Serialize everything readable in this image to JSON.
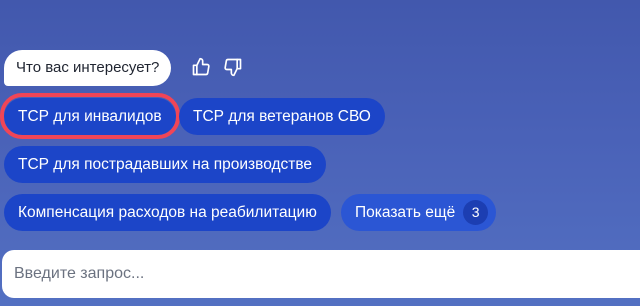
{
  "chat": {
    "question": "Что вас интересует?"
  },
  "feedback": {
    "like_icon": "thumbs-up-icon",
    "dislike_icon": "thumbs-down-icon"
  },
  "suggestions": [
    {
      "label": "ТСР для инвалидов"
    },
    {
      "label": "ТСР для ветеранов СВО"
    },
    {
      "label": "ТСР для пострадавших на производстве"
    },
    {
      "label": "Компенсация расходов на реабилитацию"
    }
  ],
  "show_more": {
    "label": "Показать ещё",
    "count": "3"
  },
  "input": {
    "placeholder": "Введите запрос...",
    "value": ""
  },
  "colors": {
    "background": "#4a62b8",
    "chip": "#1c45c8",
    "highlight": "#f04557",
    "bubble": "#ffffff"
  }
}
